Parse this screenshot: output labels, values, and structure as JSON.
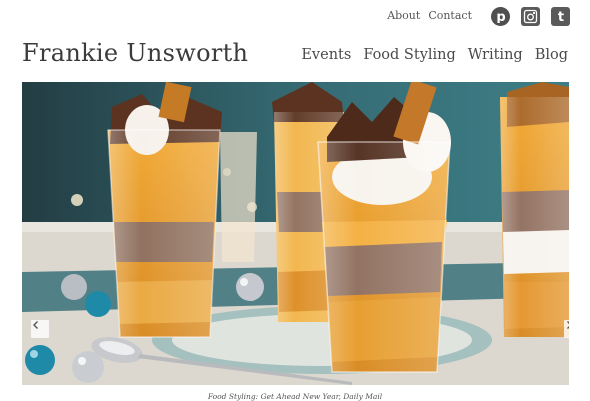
{
  "topbar": {
    "about": "About",
    "contact": "Contact",
    "social": [
      {
        "icon": "pinterest-icon"
      },
      {
        "icon": "instagram-icon"
      },
      {
        "icon": "twitter-icon"
      }
    ]
  },
  "header": {
    "title": "Frankie Unsworth",
    "nav": [
      {
        "label": "Events"
      },
      {
        "label": "Food Styling"
      },
      {
        "label": "Writing"
      },
      {
        "label": "Blog"
      }
    ]
  },
  "slideshow": {
    "caption": "Food Styling: Get Ahead New Year, Daily Mail",
    "icons": {
      "prev": "chevron-left-icon",
      "next": "chevron-right-icon"
    }
  },
  "colors": {
    "text": "#444444",
    "icon": "#555555",
    "background": "#ffffff",
    "photo_backdrop": "#2d4f55"
  }
}
